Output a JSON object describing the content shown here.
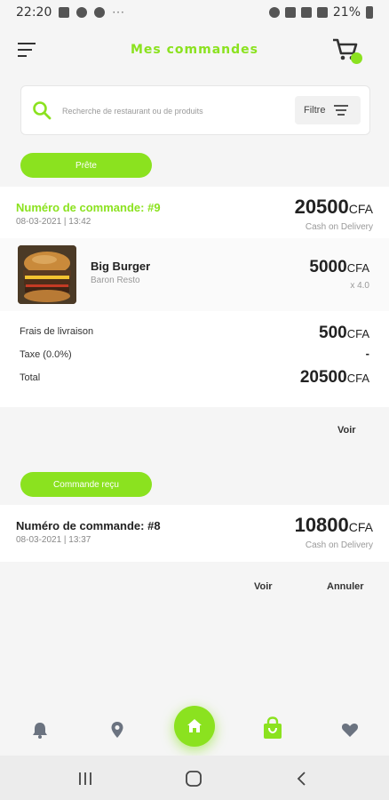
{
  "status_bar": {
    "time": "22:20",
    "more": "···",
    "battery": "21%"
  },
  "header": {
    "title": "Mes commandes"
  },
  "search": {
    "placeholder": "Recherche de restaurant ou de produits",
    "filter_label": "Filtre"
  },
  "orders": [
    {
      "status": "Prête",
      "number": "Numéro de commande: #9",
      "date": "08-03-2021 | 13:42",
      "amount": "20500",
      "currency": "CFA",
      "payment": "Cash on Delivery",
      "item": {
        "name": "Big Burger",
        "restaurant": "Baron Resto",
        "price": "5000",
        "currency": "CFA",
        "quantity": "x 4.0"
      },
      "summary": {
        "delivery_label": "Frais de livraison",
        "delivery_value": "500",
        "delivery_currency": "CFA",
        "tax_label": "Taxe (0.0%)",
        "tax_value": "-",
        "total_label": "Total",
        "total_value": "20500",
        "total_currency": "CFA"
      },
      "view_label": "Voir"
    },
    {
      "status": "Commande reçu",
      "number": "Numéro de commande: #8",
      "date": "08-03-2021 | 13:37",
      "amount": "10800",
      "currency": "CFA",
      "payment": "Cash on Delivery",
      "view_label": "Voir",
      "cancel_label": "Annuler"
    }
  ],
  "colors": {
    "accent": "#8be21f",
    "background": "#f5f5f5"
  },
  "bottom_nav": [
    "bell-icon",
    "location-pin-icon",
    "home-icon",
    "shopping-bag-icon",
    "heart-icon"
  ]
}
